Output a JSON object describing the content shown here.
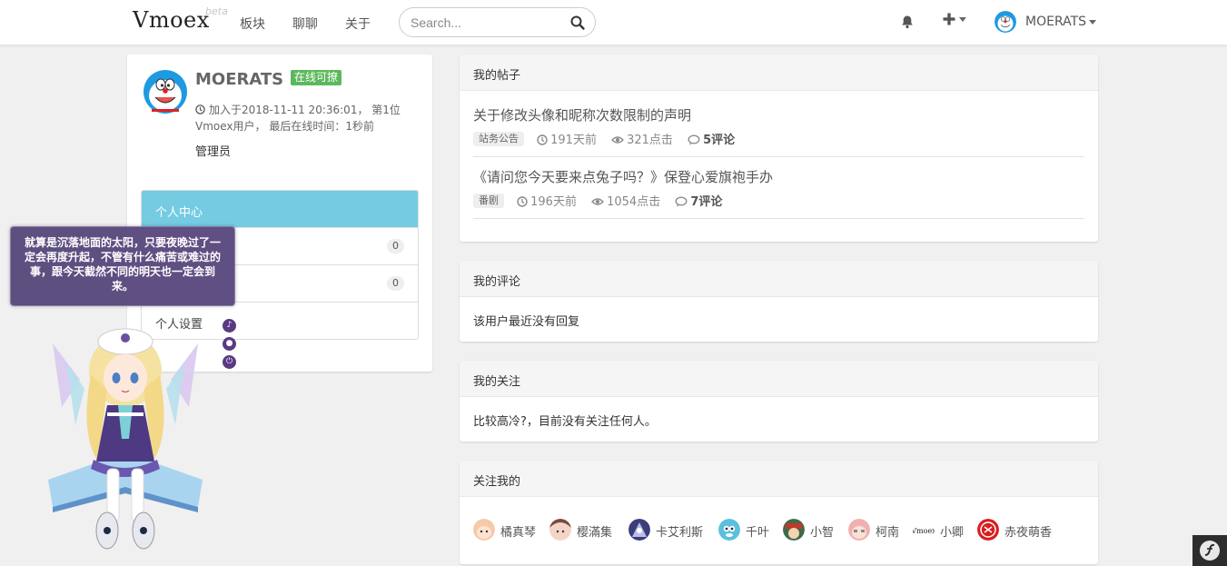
{
  "navbar": {
    "brand": "Vmoex",
    "beta": "beta",
    "links": [
      "板块",
      "聊聊",
      "关于"
    ],
    "search_placeholder": "Search...",
    "username": "MOERATS"
  },
  "profile": {
    "name": "MOERATS",
    "status_badge": "在线可撩",
    "join_info": "加入于2018-11-11 20:36:01， 第1位Vmoex用户， 最后在线时间：1秒前",
    "role": "管理员",
    "menu": [
      {
        "label": "个人中心",
        "count": ""
      },
      {
        "label": "",
        "count": "0"
      },
      {
        "label": "",
        "count": "0"
      },
      {
        "label": "个人设置",
        "count": ""
      }
    ]
  },
  "bubble": {
    "text": "就算是沉落地面的太阳，只要夜晚过了一定会再度升起，不管有什么痛苦或难过的事，跟今天截然不同的明天也一定会到来。"
  },
  "my_posts": {
    "title": "我的帖子",
    "items": [
      {
        "title": "关于修改头像和昵称次数限制的声明",
        "tag": "站务公告",
        "time": "191天前",
        "views": "321点击",
        "comments": "5评论"
      },
      {
        "title": "《请问您今天要来点兔子吗？》保登心爱旗袍手办",
        "tag": "番剧",
        "time": "196天前",
        "views": "1054点击",
        "comments": "7评论"
      }
    ]
  },
  "my_comments": {
    "title": "我的评论",
    "text": "该用户最近没有回复"
  },
  "my_follows": {
    "title": "我的关注",
    "text": "比较高冷?，目前没有关注任何人。"
  },
  "followers": {
    "title": "关注我的",
    "items": [
      {
        "name": "橘真琴",
        "color": "#f6c9a8"
      },
      {
        "name": "樱滿集",
        "color": "#e9b7a6"
      },
      {
        "name": "卡艾利斯",
        "color": "#3b3e7a"
      },
      {
        "name": "千叶",
        "color": "#5bc0de"
      },
      {
        "name": "小智",
        "color": "#3d6b4a"
      },
      {
        "name": "柯南",
        "color": "#f0b0b0"
      },
      {
        "name": "小卿",
        "color": "#ffffff",
        "logo": "Vmoex"
      },
      {
        "name": "赤夜萌香",
        "color": "#d81e1e"
      }
    ]
  },
  "colors": {
    "accent": "#75cce2",
    "online": "#5cb85c",
    "bubble": "#5a4a7e"
  }
}
